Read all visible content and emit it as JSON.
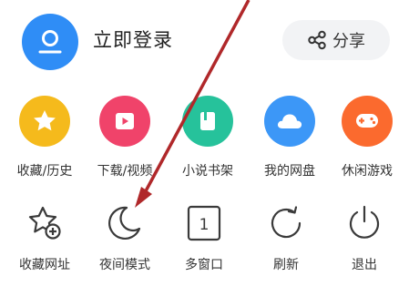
{
  "account": {
    "login_label": "立即登录",
    "avatar_color": "#2F8DF6"
  },
  "share": {
    "label": "分享",
    "icon": "share-icon"
  },
  "apps": [
    {
      "label": "收藏/历史",
      "icon": "star-icon",
      "color": "#F5BA1C"
    },
    {
      "label": "下载/视频",
      "icon": "play-icon",
      "color": "#F0436A"
    },
    {
      "label": "小说书架",
      "icon": "book-icon",
      "color": "#26C29B"
    },
    {
      "label": "我的网盘",
      "icon": "cloud-icon",
      "color": "#3C97F7"
    },
    {
      "label": "休闲游戏",
      "icon": "gamepad-icon",
      "color": "#FB6A2E"
    }
  ],
  "tools": [
    {
      "label": "收藏网址",
      "icon": "bookmark-add-icon"
    },
    {
      "label": "夜间模式",
      "icon": "moon-icon"
    },
    {
      "label": "多窗口",
      "icon": "window-count-icon",
      "count": "1"
    },
    {
      "label": "刷新",
      "icon": "refresh-icon"
    },
    {
      "label": "退出",
      "icon": "power-icon"
    }
  ],
  "annotation": {
    "arrow_color": "#B0282A"
  }
}
